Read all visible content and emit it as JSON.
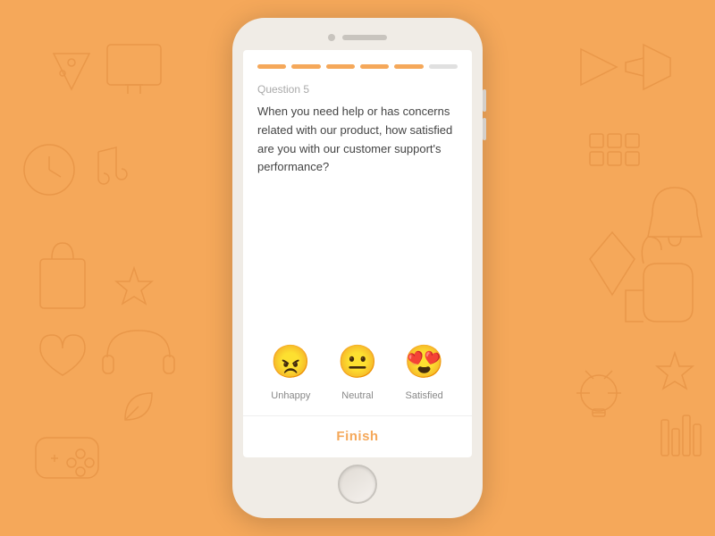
{
  "background": {
    "color": "#F5A85A"
  },
  "phone": {
    "progress": {
      "total_segments": 6,
      "filled_segments": 5,
      "label": "Progress bar"
    },
    "question": {
      "number_label": "Question 5",
      "text": "When you need help or has concerns related with our product, how satisfied are you with our customer support's performance?"
    },
    "emoji_options": [
      {
        "id": "unhappy",
        "emoji": "😠",
        "label": "Unhappy"
      },
      {
        "id": "neutral",
        "emoji": "😐",
        "label": "Neutral"
      },
      {
        "id": "satisfied",
        "emoji": "😍",
        "label": "Satisfied"
      }
    ],
    "finish_button_label": "Finish"
  }
}
